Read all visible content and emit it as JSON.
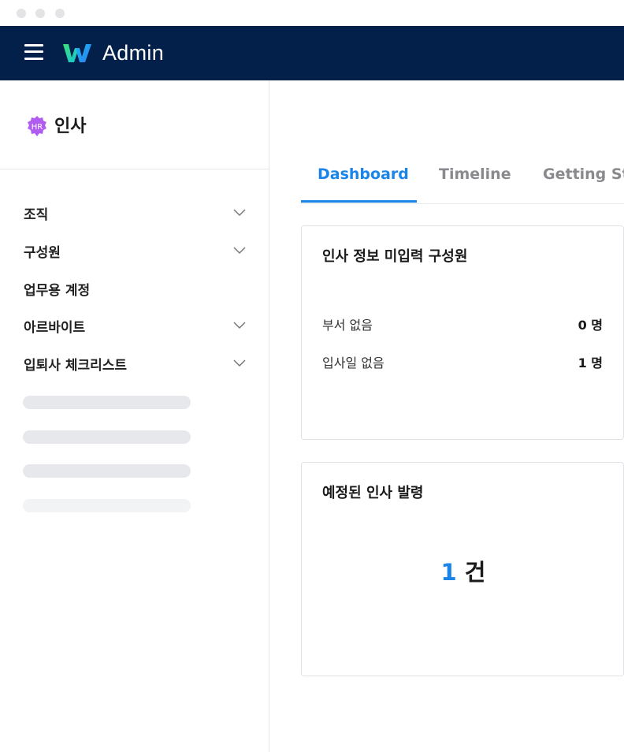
{
  "window": {
    "controls": [
      "close",
      "minimize",
      "maximize"
    ]
  },
  "topbar": {
    "brand": "Admin",
    "logo_icon": "w-logo-icon",
    "menu_icon": "hamburger-icon",
    "background": "#022049"
  },
  "sidebar": {
    "title": "인사",
    "badge": "HR",
    "items": [
      {
        "label": "조직",
        "expandable": true
      },
      {
        "label": "구성원",
        "expandable": true
      },
      {
        "label": "업무용 계정",
        "expandable": false
      },
      {
        "label": "아르바이트",
        "expandable": true
      },
      {
        "label": "입퇴사 체크리스트",
        "expandable": true
      }
    ]
  },
  "tabs": [
    {
      "label": "Dashboard",
      "active": true
    },
    {
      "label": "Timeline",
      "active": false
    },
    {
      "label": "Getting Sta",
      "active": false
    }
  ],
  "cards": {
    "missing_info": {
      "title": "인사 정보 미입력 구성원",
      "rows": [
        {
          "label": "부서 없음",
          "value": "0 명"
        },
        {
          "label": "입사일 없음",
          "value": "1 명"
        }
      ]
    },
    "scheduled": {
      "title": "예정된 인사 발령",
      "count": "1",
      "unit": "건"
    }
  },
  "colors": {
    "accent": "#1a84e8",
    "hr_badge": "#b15cf0"
  }
}
